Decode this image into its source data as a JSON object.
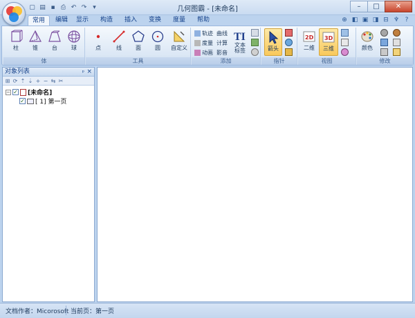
{
  "window": {
    "title": "几何图霸 - [未命名]"
  },
  "tabs": [
    "常用",
    "编辑",
    "显示",
    "构造",
    "插入",
    "变换",
    "度量",
    "帮助"
  ],
  "ribbon": {
    "groups": [
      "体",
      "工具",
      "添加",
      "指针",
      "视图",
      "修改"
    ],
    "solids": [
      "柱",
      "锥",
      "台",
      "球"
    ],
    "tools": [
      "点",
      "线",
      "面",
      "圆"
    ],
    "custom": "自定义",
    "add_small": [
      "轨迹",
      "曲线",
      "度量",
      "计算",
      "动画",
      "影音"
    ],
    "text_label": "文本\n标签",
    "arrow": "箭头",
    "view_2d": "二维",
    "view_3d": "三维",
    "color": "颜色"
  },
  "panel": {
    "title": "对象列表",
    "tree_root": "[未命名]",
    "tree_child": "[ 1] 第一页"
  },
  "status": {
    "author": "文档作者：Micorosoft",
    "page": "当前页：第一页"
  }
}
